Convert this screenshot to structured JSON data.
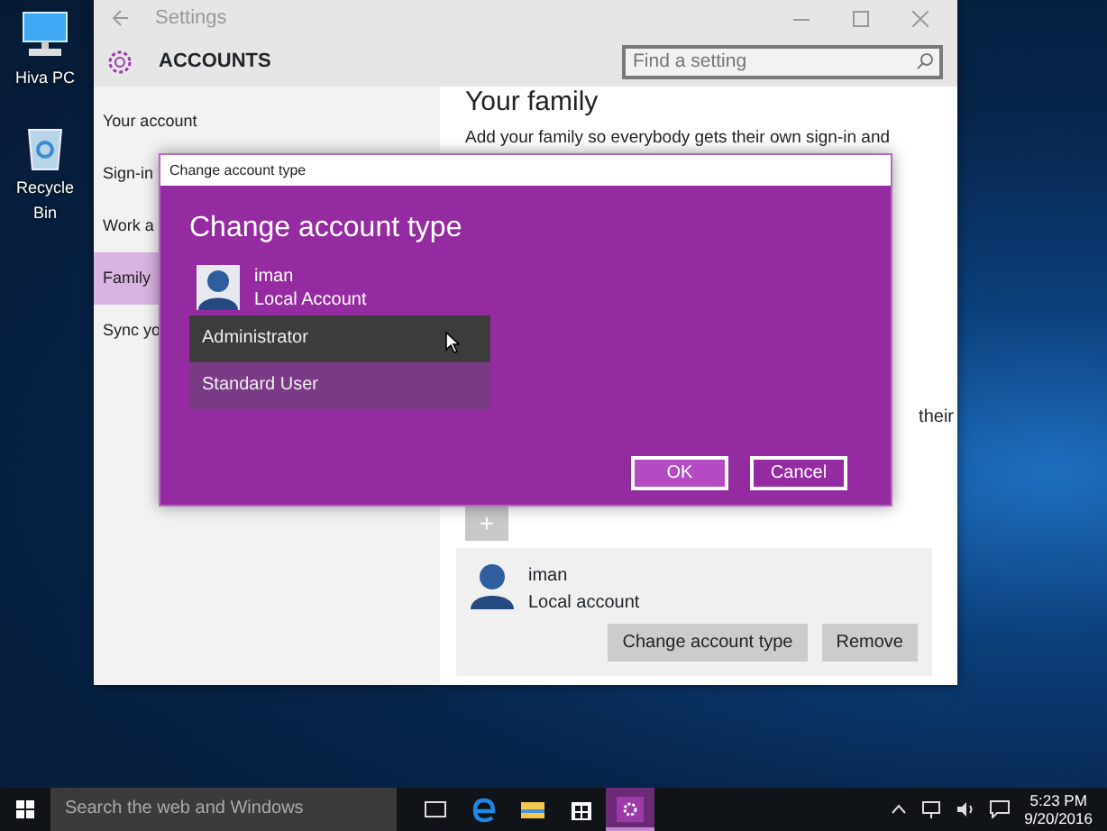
{
  "desktop_icons": [
    {
      "label": "Hiva PC",
      "kind": "computer"
    },
    {
      "label": "Recycle Bin",
      "kind": "bin"
    }
  ],
  "settings_window": {
    "title": "Settings",
    "header": "ACCOUNTS",
    "search": {
      "placeholder": "Find a setting"
    },
    "sidebar": {
      "items": [
        {
          "label": "Your account",
          "selected": false
        },
        {
          "label": "Sign-in",
          "selected": false
        },
        {
          "label": "Work a",
          "selected": false
        },
        {
          "label": "Family",
          "selected": true
        },
        {
          "label": "Sync yo",
          "selected": false
        }
      ]
    },
    "content": {
      "heading": "Your family",
      "intro": "Add your family so everybody gets their own sign-in and",
      "side_text": "their",
      "add_button": "+",
      "account": {
        "name": "iman",
        "type": "Local account",
        "buttons": [
          "Change account type",
          "Remove"
        ]
      }
    }
  },
  "dialog": {
    "title": "Change account type",
    "heading": "Change account type",
    "user": {
      "name": "iman",
      "type": "Local Account"
    },
    "options": [
      {
        "label": "Administrator",
        "selected": true
      },
      {
        "label": "Standard User",
        "selected": false
      }
    ],
    "buttons": [
      {
        "label": "OK",
        "kind": "primary"
      },
      {
        "label": "Cancel",
        "kind": "secondary"
      }
    ]
  },
  "taskbar": {
    "search": {
      "placeholder": "Search the web and Windows"
    },
    "apps": [
      {
        "kind": "task-view",
        "active": false
      },
      {
        "kind": "browser",
        "active": false
      },
      {
        "kind": "folder",
        "active": false
      },
      {
        "kind": "store",
        "active": false
      },
      {
        "kind": "settings",
        "active": true
      }
    ],
    "time": "5:23 PM",
    "date": "9/20/2016"
  }
}
